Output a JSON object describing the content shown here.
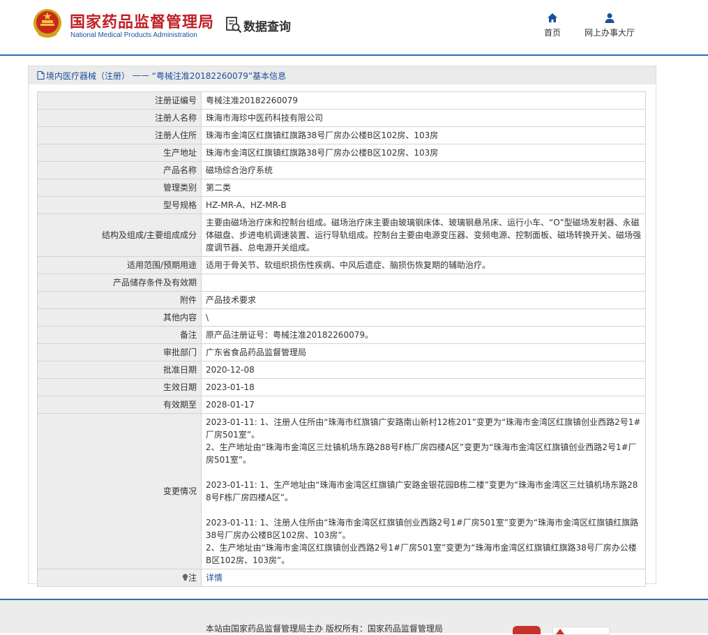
{
  "header": {
    "site_title": "国家药品监督管理局",
    "site_subtitle": "National Medical Products Administration",
    "query_label": "数据查询",
    "nav": {
      "home": "首页",
      "online_hall": "网上办事大厅"
    },
    "colors": {
      "brand_red": "#c01f26",
      "brand_blue": "#1a4f9c",
      "rule": "#2e6db4"
    }
  },
  "breadcrumb": {
    "section": "境内医疗器械（注册）",
    "separator": "——",
    "current": "“粤械注准20182260079”基本信息"
  },
  "rows": [
    {
      "label": "注册证编号",
      "value": "粤械注准20182260079"
    },
    {
      "label": "注册人名称",
      "value": "珠海市海珍中医药科技有限公司"
    },
    {
      "label": "注册人住所",
      "value": "珠海市金湾区红旗镇红旗路38号厂房办公楼B区102房、103房"
    },
    {
      "label": "生产地址",
      "value": "珠海市金湾区红旗镇红旗路38号厂房办公楼B区102房、103房"
    },
    {
      "label": "产品名称",
      "value": "磁场综合治疗系统"
    },
    {
      "label": "管理类别",
      "value": "第二类"
    },
    {
      "label": "型号规格",
      "value": "HZ-MR-A、HZ-MR-B"
    },
    {
      "label": "结构及组成/主要组成成分",
      "value": "主要由磁场治疗床和控制台组成。磁场治疗床主要由玻璃钢床体、玻璃钢悬吊床、运行小车、“O”型磁场发射器、永磁体磁盘、步进电机调速装置、运行导轨组成。控制台主要由电源变压器、变频电源、控制面板、磁场转换开关、磁场强度调节器、总电源开关组成。"
    },
    {
      "label": "适用范围/预期用途",
      "value": "适用于骨关节、软组织损伤性疾病、中风后遗症、脑损伤恢复期的辅助治疗。"
    },
    {
      "label": "产品储存条件及有效期",
      "value": ""
    },
    {
      "label": "附件",
      "value": "产品技术要求"
    },
    {
      "label": "其他内容",
      "value": "\\"
    },
    {
      "label": "备注",
      "value": "原产品注册证号：粤械注准20182260079。"
    },
    {
      "label": "审批部门",
      "value": "广东省食品药品监督管理局"
    },
    {
      "label": "批准日期",
      "value": "2020-12-08"
    },
    {
      "label": "生效日期",
      "value": "2023-01-18"
    },
    {
      "label": "有效期至",
      "value": "2028-01-17"
    },
    {
      "label": "变更情况",
      "value": "2023-01-11: 1、注册人住所由“珠海市红旗镇广安路南山新村12栋201”变更为“珠海市金湾区红旗镇创业西路2号1#厂房501室”。\n2、生产地址由“珠海市金湾区三灶镇机场东路288号F栋厂房四楼A区”变更为“珠海市金湾区红旗镇创业西路2号1#厂房501室”。\n\n2023-01-11: 1、生产地址由“珠海市金湾区红旗镇广安路金银花园B栋二楼”变更为“珠海市金湾区三灶镇机场东路288号F栋厂房四楼A区”。\n\n2023-01-11: 1、注册人住所由“珠海市金湾区红旗镇创业西路2号1#厂房501室”变更为“珠海市金湾区红旗镇红旗路38号厂房办公楼B区102房、103房”。\n2、生产地址由“珠海市金湾区红旗镇创业西路2号1#厂房501室”变更为“珠海市金湾区红旗镇红旗路38号厂房办公楼B区102房、103房”。\n"
    }
  ],
  "note": {
    "label": "注",
    "link": "详情"
  },
  "footer": {
    "text": "本站由国家药品监督管理局主办 版权所有：国家药品监督管理局"
  }
}
